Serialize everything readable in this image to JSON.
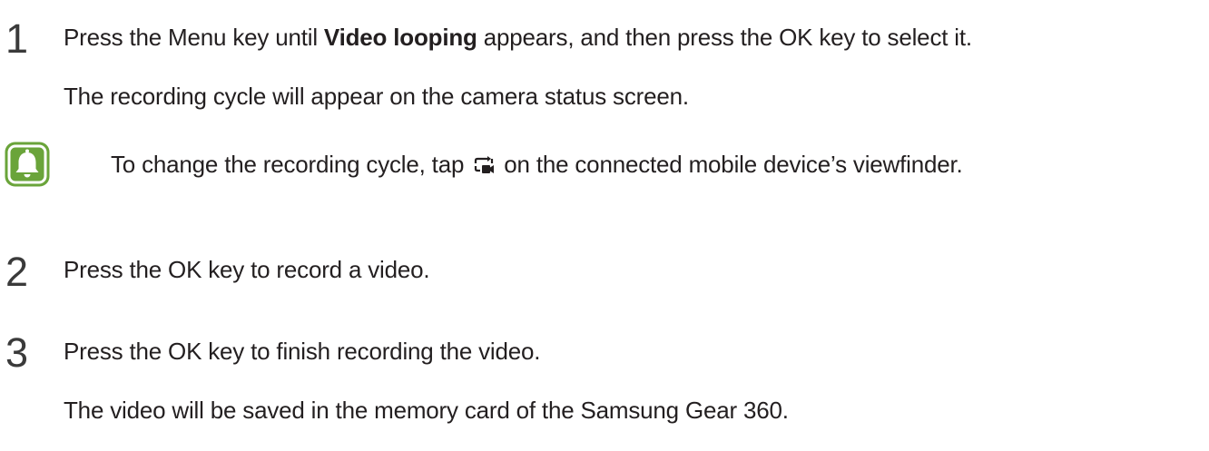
{
  "steps": [
    {
      "number": "1",
      "line1_before": "Press the Menu key until ",
      "line1_bold": "Video looping",
      "line1_after": " appears, and then press the OK key to select it.",
      "line2": "The recording cycle will appear on the camera status screen."
    },
    {
      "number": "2",
      "line1": "Press the OK key to record a video."
    },
    {
      "number": "3",
      "line1": "Press the OK key to finish recording the video.",
      "line2": "The video will be saved in the memory card of the Samsung Gear 360."
    }
  ],
  "note": {
    "icon": "bell-icon",
    "text_before": "To change the recording cycle, tap ",
    "inline_icon": "video-loop-icon",
    "text_after": " on the connected mobile device’s viewfinder.",
    "icon_color": "#6aa43a"
  }
}
